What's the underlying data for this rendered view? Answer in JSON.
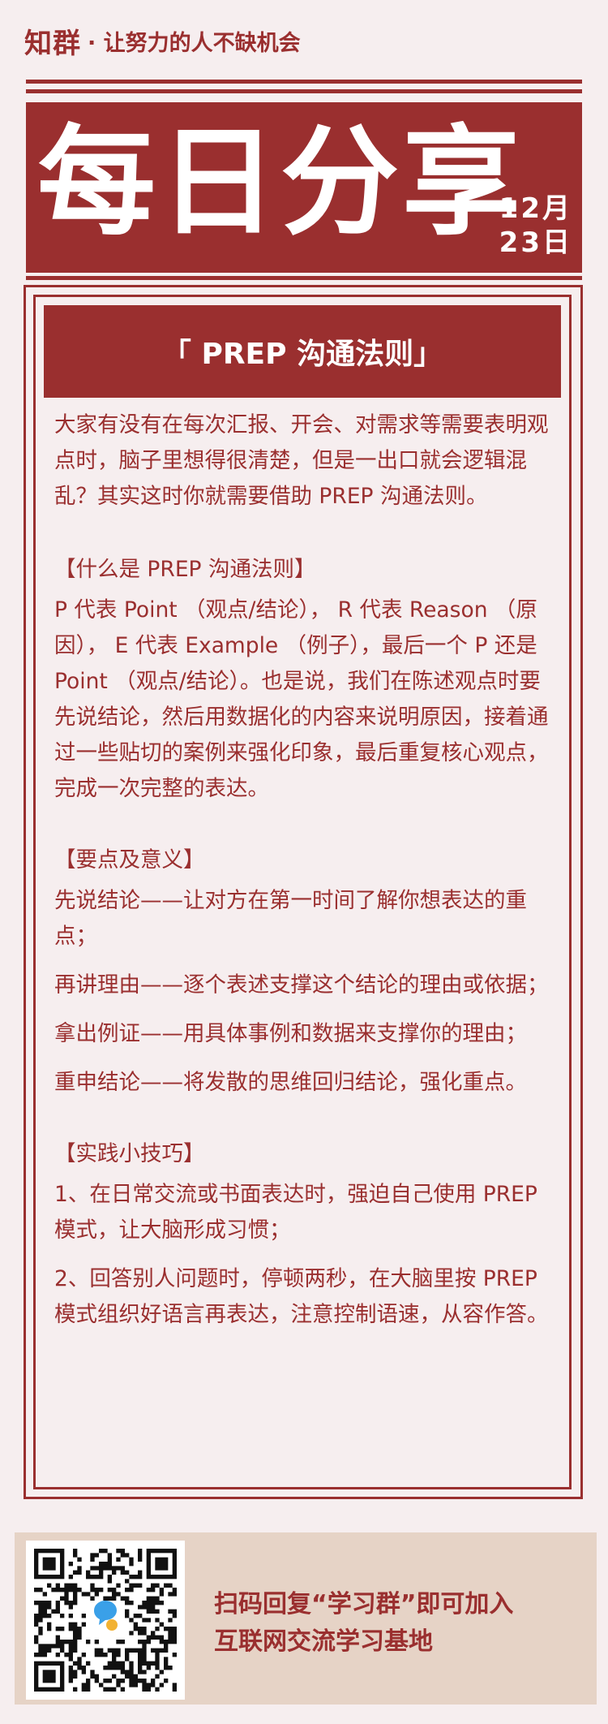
{
  "header": {
    "logo": "知群",
    "tagline": "· 让努力的人不缺机会"
  },
  "banner": {
    "title": "每日分享",
    "date_month": "12月",
    "date_day": "23日"
  },
  "section": {
    "title": "「 PREP 沟通法则」"
  },
  "content": {
    "intro": "大家有没有在每次汇报、开会、对需求等需要表明观点时，脑子里想得很清楚，但是一出口就会逻辑混乱？其实这时你就需要借助 PREP 沟通法则。",
    "what_heading": "【什么是 PREP 沟通法则】",
    "what_body": " P 代表 Point （观点/结论）， R 代表 Reason （原因）， E 代表 Example （例子），最后一个 P 还是 Point （观点/结论）。也是说，我们在陈述观点时要先说结论，然后用数据化的内容来说明原因，接着通过一些贴切的案例来强化印象，最后重复核心观点，完成一次完整的表达。",
    "points_heading": "【要点及意义】",
    "points": [
      "先说结论——让对方在第一时间了解你想表达的重点；",
      "再讲理由——逐个表述支撑这个结论的理由或依据；",
      "拿出例证——用具体事例和数据来支撑你的理由；",
      "重申结论——将发散的思维回归结论，强化重点。"
    ],
    "tips_heading": "【实践小技巧】",
    "tips": [
      "1、在日常交流或书面表达时，强迫自己使用 PREP 模式，让大脑形成习惯；",
      "2、回答别人问题时，停顿两秒，在大脑里按 PREP 模式组织好语言再表达，注意控制语速，从容作答。"
    ]
  },
  "footer": {
    "line1": "扫码回复“学习群”即可加入",
    "line2": "互联网交流学习基地",
    "qr_icon": "qr-code-icon",
    "chat_icon": "chat-bubble-icon"
  },
  "colors": {
    "brand": "#9a2f2f",
    "background": "#f6eeef",
    "footer_bg": "#e6d3c6"
  }
}
